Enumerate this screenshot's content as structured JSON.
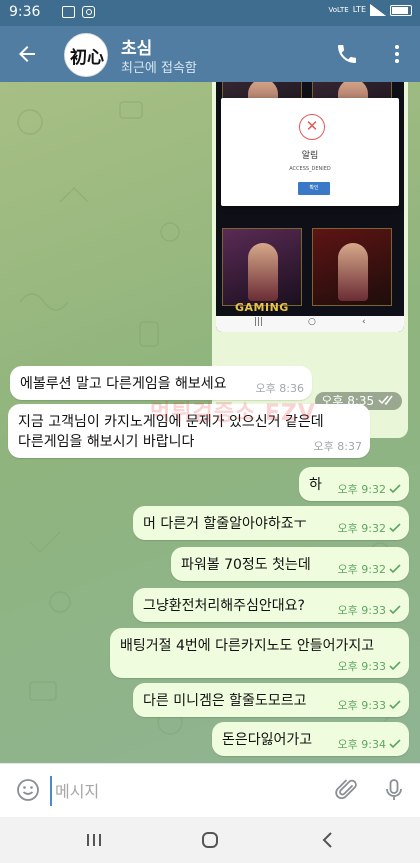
{
  "status_bar": {
    "time": "9:36",
    "volte": "VoLTE",
    "network": "LTE",
    "battery_level": 0.9
  },
  "header": {
    "name": "초심",
    "status": "최근에 접속함",
    "avatar_text": "初心"
  },
  "photo": {
    "dialog_title": "알림",
    "dialog_subtitle": "ACCESS_DENIED",
    "dialog_button": "확인",
    "brand": "GAMING",
    "time": "오후 8:35"
  },
  "messages": [
    {
      "text": "에볼루션 말고 다른게임을 해보세요",
      "time": "오후 8:36"
    },
    {
      "line1": "지금 고객님이 카지노게임에 문제가 있으신거 같은데",
      "line2": "다른게임을 해보시기 바랍니다",
      "time": "오후 8:37"
    },
    {
      "text": "하",
      "time": "오후 9:32"
    },
    {
      "text": "머 다른거 할줄알아야하죠ㅜ",
      "time": "오후 9:32"
    },
    {
      "text": "파워볼 70정도 첫는데",
      "time": "오후 9:32"
    },
    {
      "text": "그냥환전처리해주심안대요?",
      "time": "오후 9:33"
    },
    {
      "text": "배팅거절 4번에 다른카지노도 안들어가지고",
      "time": "오후 9:33"
    },
    {
      "text": "다른 미니겜은 할줄도모르고",
      "time": "오후 9:33"
    },
    {
      "text": "돈은다잃어가고",
      "time": "오후 9:34"
    }
  ],
  "watermark": "먹튀검증소 EZV",
  "input": {
    "placeholder": "메시지"
  },
  "colors": {
    "header": "#517da2",
    "statusbar": "#3e6d90",
    "outgoing": "#effdde",
    "incoming": "#ffffff",
    "check": "#5fa665"
  }
}
